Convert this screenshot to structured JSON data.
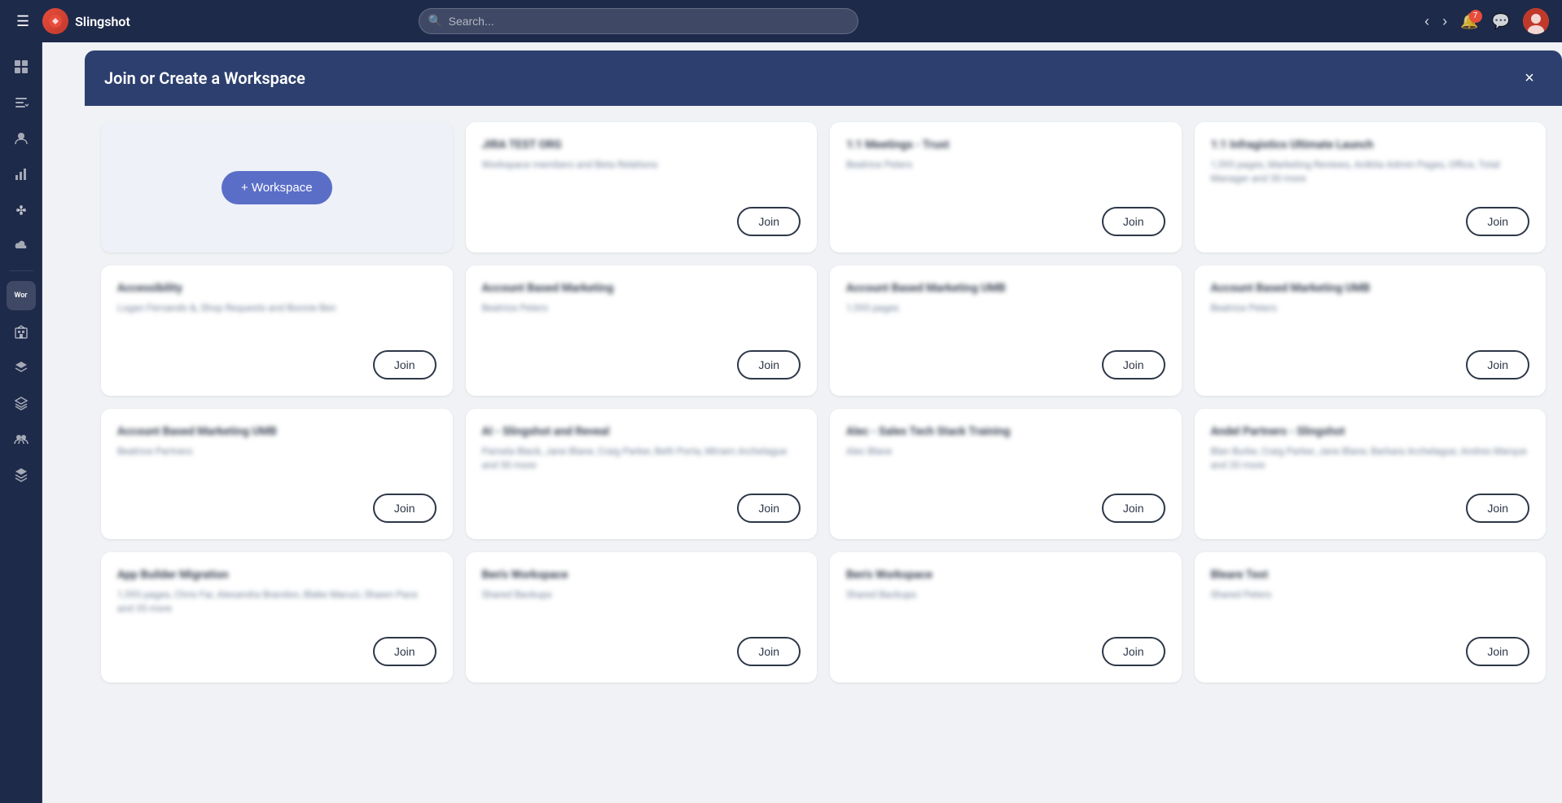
{
  "app": {
    "name": "Slingshot",
    "search_placeholder": "Search..."
  },
  "topbar": {
    "nav_badge_count": "7",
    "back_btn": "‹",
    "forward_btn": "›"
  },
  "sidebar": {
    "items": [
      {
        "id": "home",
        "icon": "⊞",
        "label": ""
      },
      {
        "id": "tasks",
        "icon": "✓",
        "label": ""
      },
      {
        "id": "people",
        "icon": "👤",
        "label": ""
      },
      {
        "id": "analytics",
        "icon": "📊",
        "label": ""
      },
      {
        "id": "integrations",
        "icon": "🔗",
        "label": ""
      },
      {
        "id": "cloud",
        "icon": "☁",
        "label": ""
      },
      {
        "id": "workspace-active",
        "icon": "Wor",
        "label": "Wor"
      },
      {
        "id": "buildings",
        "icon": "🏢",
        "label": ""
      },
      {
        "id": "layers1",
        "icon": "⬡",
        "label": ""
      },
      {
        "id": "layers2",
        "icon": "⬡",
        "label": ""
      },
      {
        "id": "group",
        "icon": "⊞",
        "label": ""
      },
      {
        "id": "layers3",
        "icon": "⬡",
        "label": ""
      }
    ]
  },
  "modal": {
    "title": "Join or Create a Workspace",
    "close_label": "×",
    "create_btn_label": "+ Workspace"
  },
  "workspaces": {
    "rows": [
      [
        {
          "id": "create",
          "type": "create"
        },
        {
          "id": "jira-test",
          "title": "JIRA TEST ORG",
          "desc": "Workspace members and Beta Relations",
          "type": "join"
        },
        {
          "id": "11-meetings",
          "title": "1:1 Meetings - Trust",
          "desc": "Beatrice Peters",
          "type": "join"
        },
        {
          "id": "infragistics",
          "title": "1:1 Infragistics Ultimate Launch",
          "desc": "1,593 pages, Marketing Reviews, Anikita Admin Pages, Office, Total Manager and 30 more",
          "type": "join"
        }
      ],
      [
        {
          "id": "accessibility",
          "title": "Accessibility",
          "desc": "Logan Fernando &, Shop Requests and Bonnie Ben",
          "type": "join"
        },
        {
          "id": "abm",
          "title": "Account Based Marketing",
          "desc": "Beatrice Peters",
          "type": "join"
        },
        {
          "id": "abm-umb",
          "title": "Account Based Marketing UMB",
          "desc": "1,593 pages",
          "type": "join"
        },
        {
          "id": "abm-umb2",
          "title": "Account Based Marketing UMB",
          "desc": "Beatrice Peters",
          "type": "join"
        }
      ],
      [
        {
          "id": "abm-umb3",
          "title": "Account Based Marketing UMB",
          "desc": "Beatrice Partners",
          "type": "join"
        },
        {
          "id": "ai-slingshot",
          "title": "AI - Slingshot and Reveal",
          "desc": "Pamela Black, Jane Blane, Craig Parker, Beth Porta, Miriam Archelague and 50 more",
          "type": "join"
        },
        {
          "id": "alec-sales",
          "title": "Alec - Sales Tech Stack Training",
          "desc": "Alec Blane",
          "type": "join"
        },
        {
          "id": "anded-partners",
          "title": "Andel Partners - Slingshot",
          "desc": "Blan Burke, Craig Parker, Jane Blane, Barbara Archelague, Andres Marque and 20 more",
          "type": "join"
        }
      ],
      [
        {
          "id": "app-builder",
          "title": "App Builder Migration",
          "desc": "1,593 pages, Chris Far, Alexandra Brandon, Blake Maruci, Shawn Pace and 35 more",
          "type": "join"
        },
        {
          "id": "ben-workspace",
          "title": "Ben's Workspace",
          "desc": "Shared Backups",
          "type": "join"
        },
        {
          "id": "ben-workspace2",
          "title": "Ben's Workspace",
          "desc": "Shared Backups",
          "type": "join"
        },
        {
          "id": "bleare-test",
          "title": "Bleare Test",
          "desc": "Shared Peters",
          "type": "join"
        }
      ]
    ],
    "join_btn_label": "Join"
  }
}
